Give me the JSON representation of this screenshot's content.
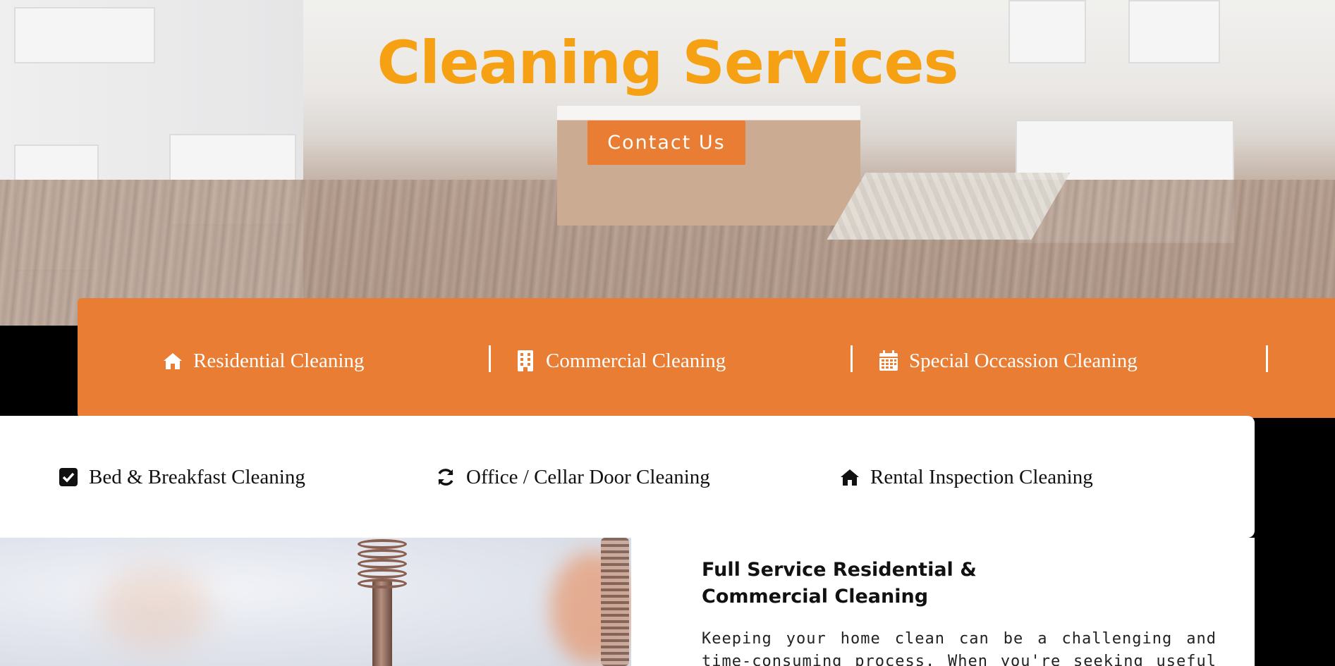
{
  "hero": {
    "title": "Cleaning Services",
    "contact_label": "Contact Us"
  },
  "service_bar": {
    "items": [
      {
        "label": "Residential Cleaning",
        "icon": "home-icon"
      },
      {
        "label": "Commercial Cleaning",
        "icon": "building-icon"
      },
      {
        "label": "Special Occassion Cleaning",
        "icon": "calendar-icon"
      }
    ]
  },
  "sub_services": {
    "items": [
      {
        "label": "Bed & Breakfast Cleaning",
        "icon": "checkbox-icon"
      },
      {
        "label": "Office / Cellar Door Cleaning",
        "icon": "refresh-icon"
      },
      {
        "label": "Rental Inspection Cleaning",
        "icon": "home-icon"
      }
    ]
  },
  "content": {
    "title": "Full Service Residential & Commercial Cleaning",
    "body": "Keeping your home clean can be a challenging and time-consuming process. When you're seeking useful house"
  },
  "colors": {
    "accent": "#ea7d34",
    "title": "#f6a113"
  }
}
